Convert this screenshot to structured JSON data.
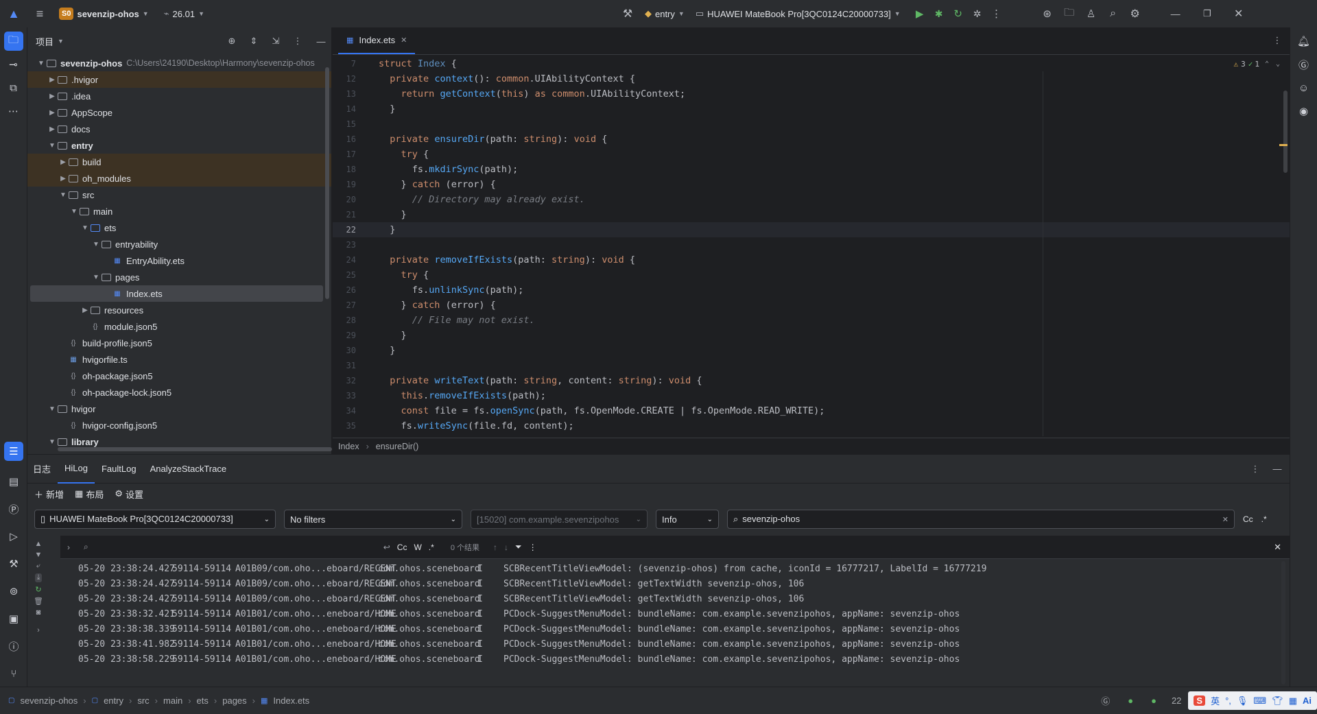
{
  "titlebar": {
    "project_badge": "S0",
    "project_name": "sevenzip-ohos",
    "version": "26.01",
    "module": "entry",
    "device": "HUAWEI MateBook Pro[3QC0124C20000733]"
  },
  "project_panel": {
    "title": "项目",
    "root_name": "sevenzip-ohos",
    "root_path": "C:\\Users\\24190\\Desktop\\Harmony\\sevenzip-ohos",
    "items": [
      {
        "label": ".hvigor",
        "depth": 1,
        "kind": "folder",
        "chev": "right",
        "excluded": true
      },
      {
        "label": ".idea",
        "depth": 1,
        "kind": "folder",
        "chev": "right"
      },
      {
        "label": "AppScope",
        "depth": 1,
        "kind": "folder",
        "chev": "right"
      },
      {
        "label": "docs",
        "depth": 1,
        "kind": "folder",
        "chev": "right"
      },
      {
        "label": "entry",
        "depth": 1,
        "kind": "folder",
        "chev": "down",
        "bold": true
      },
      {
        "label": "build",
        "depth": 2,
        "kind": "folder",
        "chev": "right",
        "excluded": true
      },
      {
        "label": "oh_modules",
        "depth": 2,
        "kind": "folder",
        "chev": "right",
        "excluded": true
      },
      {
        "label": "src",
        "depth": 2,
        "kind": "folder",
        "chev": "down"
      },
      {
        "label": "main",
        "depth": 3,
        "kind": "folder",
        "chev": "down"
      },
      {
        "label": "ets",
        "depth": 4,
        "kind": "folder-blue",
        "chev": "down"
      },
      {
        "label": "entryability",
        "depth": 5,
        "kind": "folder",
        "chev": "down"
      },
      {
        "label": "EntryAbility.ets",
        "depth": 6,
        "kind": "ets"
      },
      {
        "label": "pages",
        "depth": 5,
        "kind": "folder",
        "chev": "down"
      },
      {
        "label": "Index.ets",
        "depth": 6,
        "kind": "ets",
        "selected": true
      },
      {
        "label": "resources",
        "depth": 4,
        "kind": "folder",
        "chev": "right"
      },
      {
        "label": "module.json5",
        "depth": 4,
        "kind": "json"
      },
      {
        "label": "build-profile.json5",
        "depth": 2,
        "kind": "json"
      },
      {
        "label": "hvigorfile.ts",
        "depth": 2,
        "kind": "ts"
      },
      {
        "label": "oh-package.json5",
        "depth": 2,
        "kind": "json"
      },
      {
        "label": "oh-package-lock.json5",
        "depth": 2,
        "kind": "json"
      },
      {
        "label": "hvigor",
        "depth": 1,
        "kind": "folder",
        "chev": "down"
      },
      {
        "label": "hvigor-config.json5",
        "depth": 2,
        "kind": "json"
      },
      {
        "label": "library",
        "depth": 1,
        "kind": "folder",
        "chev": "down",
        "bold": true
      }
    ]
  },
  "editor": {
    "tab": "Index.ets",
    "sticky": "struct Index {",
    "sticky_line": "7",
    "warnings": "3",
    "checks": "1",
    "lines": [
      {
        "n": "12",
        "t": "  private context(): common.UIAbilityContext {"
      },
      {
        "n": "13",
        "t": "    return getContext(this) as common.UIAbilityContext;"
      },
      {
        "n": "14",
        "t": "  }"
      },
      {
        "n": "15",
        "t": ""
      },
      {
        "n": "16",
        "t": "  private ensureDir(path: string): void {"
      },
      {
        "n": "17",
        "t": "    try {"
      },
      {
        "n": "18",
        "t": "      fs.mkdirSync(path);"
      },
      {
        "n": "19",
        "t": "    } catch (error) {"
      },
      {
        "n": "20",
        "t": "      // Directory may already exist."
      },
      {
        "n": "21",
        "t": "    }"
      },
      {
        "n": "22",
        "t": "  }",
        "cur": true
      },
      {
        "n": "23",
        "t": ""
      },
      {
        "n": "24",
        "t": "  private removeIfExists(path: string): void {"
      },
      {
        "n": "25",
        "t": "    try {"
      },
      {
        "n": "26",
        "t": "      fs.unlinkSync(path);"
      },
      {
        "n": "27",
        "t": "    } catch (error) {"
      },
      {
        "n": "28",
        "t": "      // File may not exist."
      },
      {
        "n": "29",
        "t": "    }"
      },
      {
        "n": "30",
        "t": "  }"
      },
      {
        "n": "31",
        "t": ""
      },
      {
        "n": "32",
        "t": "  private writeText(path: string, content: string): void {"
      },
      {
        "n": "33",
        "t": "    this.removeIfExists(path);"
      },
      {
        "n": "34",
        "t": "    const file = fs.openSync(path, fs.OpenMode.CREATE | fs.OpenMode.READ_WRITE);"
      },
      {
        "n": "35",
        "t": "    fs.writeSync(file.fd, content);"
      }
    ],
    "breadcrumb": [
      "Index",
      "ensureDir()"
    ]
  },
  "log": {
    "title": "日志",
    "tabs": [
      "HiLog",
      "FaultLog",
      "AnalyzeStackTrace"
    ],
    "actions": [
      "新增",
      "布局",
      "设置"
    ],
    "device": "HUAWEI MateBook Pro[3QC0124C20000733]",
    "filter": "No filters",
    "process": "[15020] com.example.sevenzipohos",
    "level": "Info",
    "search": "sevenzip-ohos",
    "result_count": "0 个结果",
    "rows": [
      [
        "05-20 23:38:24.427",
        "59114-59114",
        "A01B09/com.oho...eboard/RECENT",
        "com.ohos.sceneboard",
        "I",
        "SCBRecentTitleViewModel: (sevenzip-ohos) from cache, iconId = 16777217, LabelId = 16777219"
      ],
      [
        "05-20 23:38:24.427",
        "59114-59114",
        "A01B09/com.oho...eboard/RECENT",
        "com.ohos.sceneboard",
        "I",
        "SCBRecentTitleViewModel: getTextWidth sevenzip-ohos, 106"
      ],
      [
        "05-20 23:38:24.427",
        "59114-59114",
        "A01B09/com.oho...eboard/RECENT",
        "com.ohos.sceneboard",
        "I",
        "SCBRecentTitleViewModel: getTextWidth sevenzip-ohos, 106"
      ],
      [
        "05-20 23:38:32.421",
        "59114-59114",
        "A01B01/com.oho...eneboard/HOME",
        "com.ohos.sceneboard",
        "I",
        "PCDock-SuggestMenuModel: bundleName: com.example.sevenzipohos, appName: sevenzip-ohos"
      ],
      [
        "05-20 23:38:38.339",
        "59114-59114",
        "A01B01/com.oho...eneboard/HOME",
        "com.ohos.sceneboard",
        "I",
        "PCDock-SuggestMenuModel: bundleName: com.example.sevenzipohos, appName: sevenzip-ohos"
      ],
      [
        "05-20 23:38:41.982",
        "59114-59114",
        "A01B01/com.oho...eneboard/HOME",
        "com.ohos.sceneboard",
        "I",
        "PCDock-SuggestMenuModel: bundleName: com.example.sevenzipohos, appName: sevenzip-ohos"
      ],
      [
        "05-20 23:38:58.229",
        "59114-59114",
        "A01B01/com.oho...eneboard/HOME",
        "com.ohos.sceneboard",
        "I",
        "PCDock-SuggestMenuModel: bundleName: com.example.sevenzipohos, appName: sevenzip-ohos"
      ]
    ]
  },
  "statusbar": {
    "path": [
      "sevenzip-ohos",
      "entry",
      "src",
      "main",
      "ets",
      "pages",
      "Index.ets"
    ],
    "time": "22",
    "ime": [
      "英",
      "°,",
      "Ai"
    ]
  },
  "colors": {
    "accent": "#3574f0",
    "bg": "#1e1f22",
    "panel": "#2b2d30",
    "keyword": "#cf8e6d",
    "function": "#56a8f5",
    "excluded": "#3d3223"
  }
}
